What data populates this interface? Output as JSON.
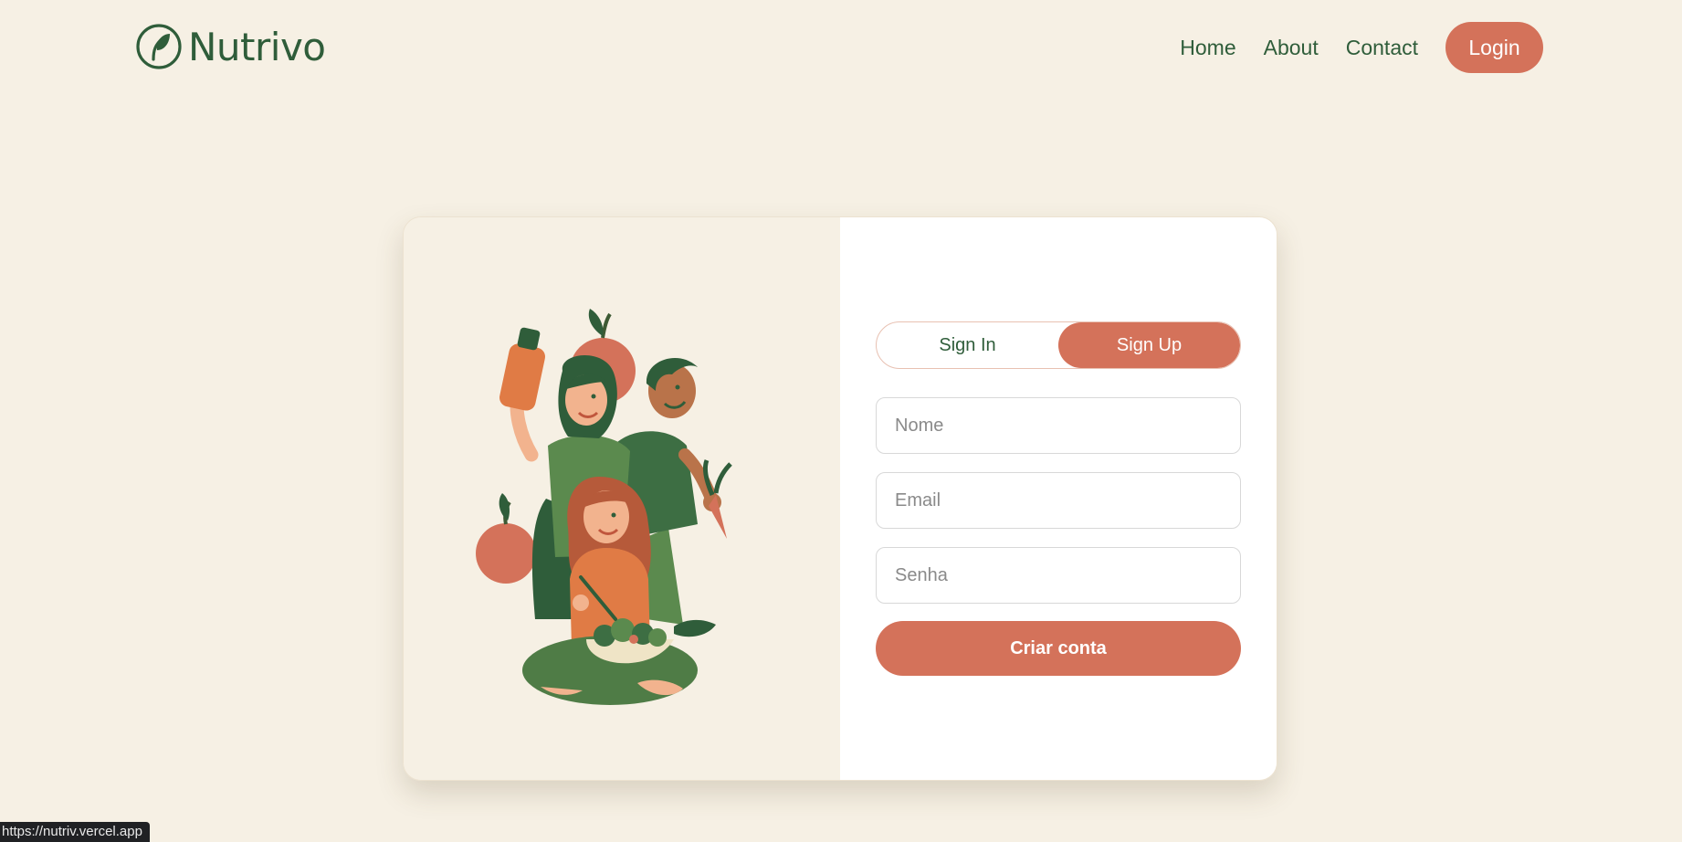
{
  "brand": {
    "name": "Nutrivo"
  },
  "nav": {
    "items": [
      "Home",
      "About",
      "Contact"
    ],
    "login_label": "Login"
  },
  "auth": {
    "tabs": [
      {
        "label": "Sign In",
        "active": false
      },
      {
        "label": "Sign Up",
        "active": true
      }
    ],
    "fields": {
      "name": {
        "placeholder": "Nome",
        "value": ""
      },
      "email": {
        "placeholder": "Email",
        "value": ""
      },
      "password": {
        "placeholder": "Senha",
        "value": ""
      }
    },
    "submit_label": "Criar conta"
  },
  "illustration": {
    "icon": "people-healthy-food-illustration"
  },
  "status_bar": {
    "url": "https://nutriv.vercel.app"
  },
  "colors": {
    "background": "#f6f0e4",
    "brand_green": "#2f5d3a",
    "accent": "#d4725a",
    "card_right": "#ffffff"
  }
}
